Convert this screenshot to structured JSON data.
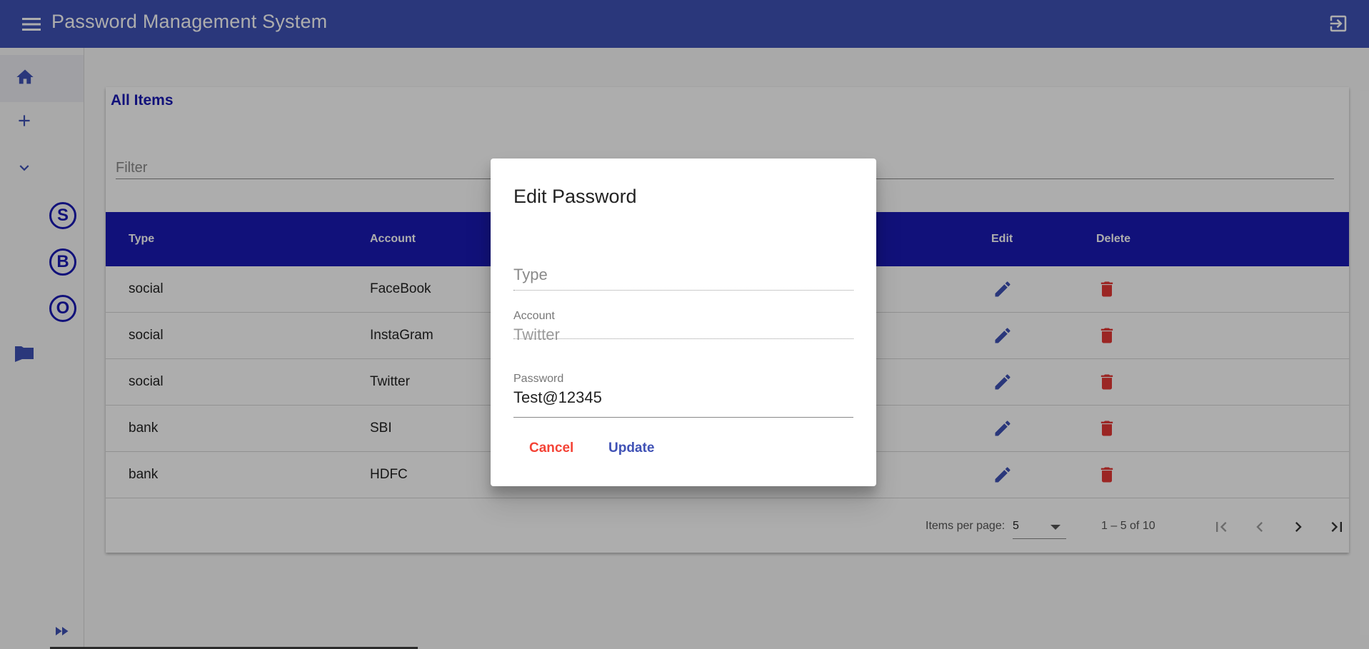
{
  "app": {
    "title": "Password Management System"
  },
  "sidenav": {
    "letters": [
      "S",
      "B",
      "O"
    ]
  },
  "card": {
    "title": "All Items",
    "filter_placeholder": "Filter"
  },
  "table": {
    "headers": {
      "type": "Type",
      "account": "Account",
      "edit": "Edit",
      "delete": "Delete"
    },
    "rows": [
      {
        "type": "social",
        "account": "FaceBook"
      },
      {
        "type": "social",
        "account": "InstaGram"
      },
      {
        "type": "social",
        "account": "Twitter"
      },
      {
        "type": "bank",
        "account": "SBI"
      },
      {
        "type": "bank",
        "account": "HDFC"
      }
    ]
  },
  "paginator": {
    "items_per_page_label": "Items per page:",
    "page_size": "5",
    "range": "1 – 5 of 10"
  },
  "dialog": {
    "title": "Edit Password",
    "type_placeholder": "Type",
    "account_label": "Account",
    "account_value": "Twitter",
    "password_label": "Password",
    "password_value": "Test@12345",
    "cancel_label": "Cancel",
    "update_label": "Update"
  },
  "colors": {
    "primary": "#3f51b5",
    "table_header": "#1a1ab4",
    "delete": "#e53935",
    "edit": "#3f51b5"
  },
  "icons": [
    "menu-icon",
    "logout-icon",
    "home-icon",
    "add-icon",
    "expand-icon",
    "folder-icon",
    "fast-forward-icon",
    "edit-icon",
    "delete-icon",
    "first-page-icon",
    "prev-page-icon",
    "next-page-icon",
    "last-page-icon"
  ]
}
